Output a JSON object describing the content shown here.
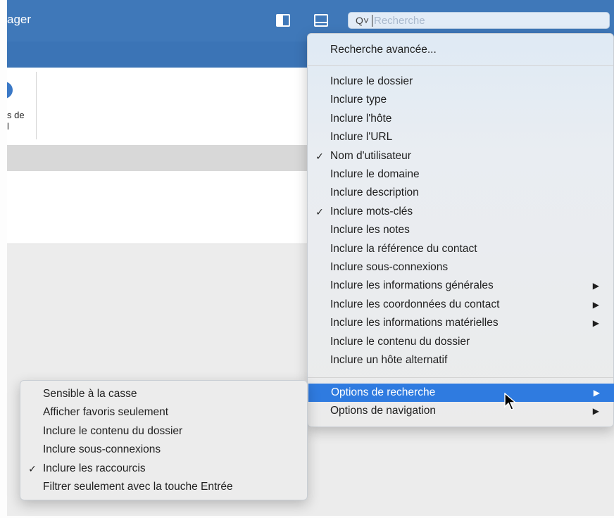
{
  "window": {
    "title_fragment": "ager"
  },
  "toolbar": {
    "icons": [
      "left-pane-toggle-icon",
      "bottom-pane-toggle-icon"
    ],
    "search": {
      "glyph": "Q˅",
      "placeholder": "Recherche"
    }
  },
  "ribbon": {
    "button_label_line1": "s de",
    "button_label_line2": "l"
  },
  "search_menu": {
    "header_item": "Recherche avancée...",
    "items": [
      {
        "label": "Inclure le dossier",
        "checked": false
      },
      {
        "label": "Inclure type",
        "checked": false
      },
      {
        "label": "Inclure l'hôte",
        "checked": false
      },
      {
        "label": "Inclure l'URL",
        "checked": false
      },
      {
        "label": "Nom d'utilisateur",
        "checked": true
      },
      {
        "label": "Inclure le domaine",
        "checked": false
      },
      {
        "label": "Inclure description",
        "checked": false
      },
      {
        "label": "Inclure mots-clés",
        "checked": true
      },
      {
        "label": "Inclure les notes",
        "checked": false
      },
      {
        "label": "Inclure la référence du contact",
        "checked": false
      },
      {
        "label": "Inclure sous-connexions",
        "checked": false
      },
      {
        "label": "Inclure les informations générales",
        "checked": false,
        "submenu": true
      },
      {
        "label": "Inclure les coordonnées du contact",
        "checked": false,
        "submenu": true
      },
      {
        "label": "Inclure les informations matérielles",
        "checked": false,
        "submenu": true
      },
      {
        "label": "Inclure le contenu du dossier",
        "checked": false
      },
      {
        "label": "Inclure un hôte alternatif",
        "checked": false
      }
    ],
    "options_items": [
      {
        "label": "Options de recherche",
        "submenu": true,
        "highlighted": true
      },
      {
        "label": "Options de navigation",
        "submenu": true,
        "highlighted": false
      }
    ],
    "check_glyph": "✓",
    "arrow_glyph": "▶"
  },
  "options_submenu": {
    "items": [
      {
        "label": "Sensible à la casse",
        "checked": false
      },
      {
        "label": "Afficher favoris seulement",
        "checked": false
      },
      {
        "label": "Inclure le contenu du dossier",
        "checked": false
      },
      {
        "label": "Inclure sous-connexions",
        "checked": false
      },
      {
        "label": "Inclure les raccourcis",
        "checked": true
      },
      {
        "label": "Filtrer seulement avec la touche Entrée",
        "checked": false
      }
    ]
  },
  "colors": {
    "titlebar": "#3f78b9",
    "highlight": "#2f7be0",
    "menu_bg": "#ebebeb"
  }
}
